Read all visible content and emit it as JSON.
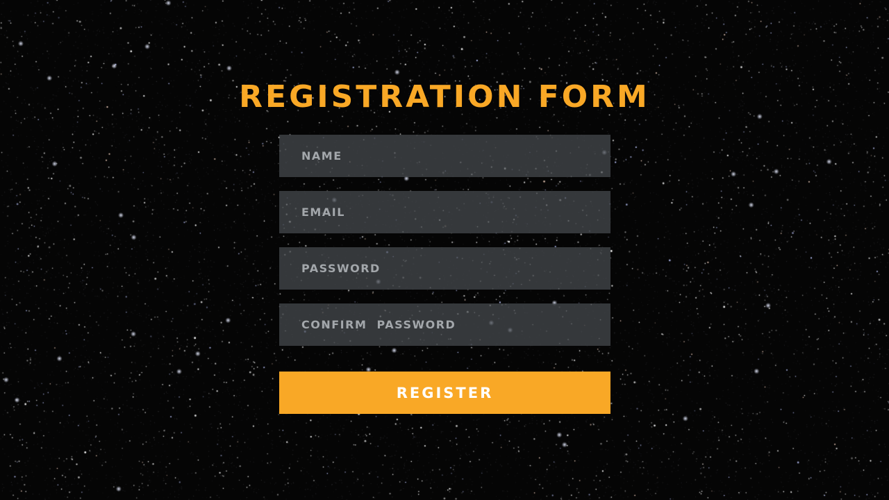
{
  "page": {
    "title": "REGISTRATION FORM"
  },
  "form": {
    "fields": [
      {
        "name": "name",
        "type": "text",
        "placeholder": "NAME",
        "value": ""
      },
      {
        "name": "email",
        "type": "email",
        "placeholder": "EMAIL",
        "value": ""
      },
      {
        "name": "password",
        "type": "password",
        "placeholder": "PASSWORD",
        "value": ""
      },
      {
        "name": "confirm_password",
        "type": "password",
        "placeholder": "CONFIRM  PASSWORD",
        "value": ""
      }
    ],
    "submit_label": "REGISTER"
  },
  "colors": {
    "accent": "#F9A826",
    "background": "#050505",
    "field_background": "#3A3E42",
    "button_text": "#FFFFFF"
  },
  "background_image": "starfield"
}
